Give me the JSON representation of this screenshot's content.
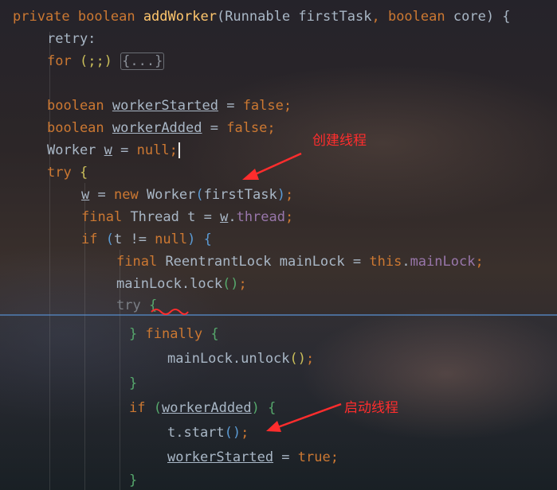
{
  "editor": {
    "method_signature": {
      "modifier": "private",
      "return_type": "boolean",
      "name": "addWorker",
      "open_paren": "(",
      "param1_type": "Runnable",
      "param1_name": "firstTask",
      "comma": ",",
      "param2_type": "boolean",
      "param2_name": "core",
      "close": ") {"
    },
    "label_retry": "retry:",
    "for_loop": {
      "keyword": "for",
      "header": "(;;)",
      "folded": "{...}"
    },
    "decl_started": {
      "type": "boolean",
      "name": "workerStarted",
      "assign": " = ",
      "value": "false",
      "end": ";"
    },
    "decl_added": {
      "type": "boolean",
      "name": "workerAdded",
      "assign": " = ",
      "value": "false",
      "end": ";"
    },
    "decl_worker": {
      "type": "Worker",
      "name": "w",
      "assign": " = ",
      "value": "null",
      "end": ";"
    },
    "try_outer": {
      "keyword": "try",
      "brace": "{"
    },
    "new_worker": {
      "var": "w",
      "assign": " = ",
      "keyword": "new",
      "cls": "Worker",
      "paren_open": "(",
      "arg": "firstTask",
      "paren_close": ")",
      "end": ";"
    },
    "thread_decl": {
      "keyword": "final",
      "type": "Thread",
      "name": "t",
      "assign": " = ",
      "var": "w",
      "dot": ".",
      "field": "thread",
      "end": ";"
    },
    "if_null": {
      "keyword": "if",
      "paren_open": "(",
      "cond": "t != ",
      "null_kw": "null",
      "paren_close": ")",
      "brace": "{"
    },
    "lock_decl": {
      "keyword": "final",
      "type": "ReentrantLock",
      "name": "mainLock",
      "assign": " = ",
      "this_kw": "this",
      "dot": ".",
      "field": "mainLock",
      "end": ";"
    },
    "lock_call": {
      "text": "mainLock.lock",
      "parens": "()",
      "end": ";"
    },
    "try_inner": {
      "keyword": "try",
      "brace": "{"
    },
    "finally_line": {
      "close": "}",
      "keyword": "finally",
      "brace": "{"
    },
    "unlock_call": {
      "text": "mainLock.unlock",
      "parens": "()",
      "end": ";"
    },
    "close_brace": "}",
    "if_added": {
      "keyword": "if",
      "paren_open": "(",
      "cond": "workerAdded",
      "paren_close": ")",
      "brace": "{"
    },
    "start_call": {
      "text": "t.start",
      "parens": "()",
      "end": ";"
    },
    "set_started": {
      "name": "workerStarted",
      "assign": " = ",
      "value": "true",
      "end": ";"
    },
    "close_brace_bottom": "}"
  },
  "annotations": {
    "create_thread": "创建线程",
    "start_thread": "启动线程",
    "color": "#ff2d2d"
  },
  "colors": {
    "keyword": "#cc7832",
    "method_name": "#ffc66d",
    "field": "#9876aa",
    "default_text": "#a9b7c6",
    "fold_separator": "#4a6c96"
  }
}
